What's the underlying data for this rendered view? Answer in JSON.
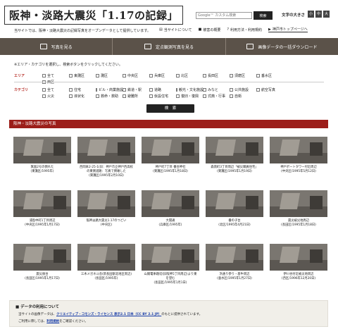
{
  "header": {
    "title": "阪神・淡路大震災「1.17の記録」",
    "search_placeholder": "Google™ カスタム検索",
    "search_button": "検索",
    "fontsize_label": "文字の大きさ",
    "fontsize_options": [
      "小",
      "中",
      "大"
    ]
  },
  "intro": "当サイトでは、阪神・淡路大震災の記録写真をオープンデータとして提供しています。",
  "toplinks": [
    {
      "label": "当サイトについて",
      "icon": "page-icon"
    },
    {
      "label": "被害の概要",
      "icon": "folder-icon"
    },
    {
      "label": "利用方法・利用規約",
      "icon": "question-icon"
    },
    {
      "label": "神戸市トップページへ",
      "icon": "arrow-icon"
    }
  ],
  "nav": [
    {
      "label": "写真を見る",
      "icon": "photo-icon"
    },
    {
      "label": "定点観測写真を見る",
      "icon": "camera-icon"
    },
    {
      "label": "画像データの一括ダウンロード",
      "icon": "download-icon"
    }
  ],
  "filter": {
    "note": "※エリア・カテゴリを選択し、検索ボタンをクリックしてください。",
    "area_label": "エリア",
    "areas": [
      "全て",
      "東灘区",
      "灘区",
      "中央区",
      "兵庫区",
      "北区",
      "長田区",
      "須磨区",
      "垂水区",
      "西区"
    ],
    "category_label": "カテゴリ",
    "categories": [
      "全て",
      "住宅",
      "ビル・商業施設",
      "鉄道・駅",
      "道路",
      "観光・文化施設",
      "みなと",
      "公共施設",
      "航空写真",
      "火災",
      "液状化",
      "救命・救助",
      "避難所",
      "仮設住宅",
      "復旧・復興",
      "式典・行事",
      "自衛"
    ],
    "search_button": "検　索"
  },
  "section_title": "阪神・淡路大震災の写真",
  "photos": [
    {
      "caption_1": "箕面2号の倒れた",
      "caption_2": "(東灘区/1995年)"
    },
    {
      "caption_1": "西岡本2-25-1(旧：神戸市立神戸西高校",
      "caption_2": "の東側道路：写真で倒壊した",
      "caption_3": "(東灘区/1995年2月10日)"
    },
    {
      "caption_1": "神戸町7丁目 番台神社",
      "caption_2": "(東灘区/1995年1月18日)"
    },
    {
      "caption_1": "森南町3丁目周辺「被災職員住宅」",
      "caption_2": "(東灘区/1995年1月19日)"
    },
    {
      "caption_1": "神戸ポートタワー付近周辺",
      "caption_2": "(中央区/1995年5月12日)"
    },
    {
      "caption_1": "浦島中町1丁目周辺",
      "caption_2": "(中央区/1995年1月17日)"
    },
    {
      "caption_1": "阪神淡路大震災1.17のつどい",
      "caption_2": "(中央区)"
    },
    {
      "caption_1": "大開通",
      "caption_2": "(兵庫区/1995年)"
    },
    {
      "caption_1": "番の子台",
      "caption_2": "(北区/1995年4月21日)"
    },
    {
      "caption_1": "震災被災地周辺",
      "caption_2": "(長田区/1995年1月18日)"
    },
    {
      "caption_1": "震災後台",
      "caption_2": "(長田区/1995年1月17日)"
    },
    {
      "caption_1": "三木メガネ斗舎(新長田駅北地区周辺)",
      "caption_2": "(長田区/1995年)"
    },
    {
      "caption_1": "山陽電車踏切(旧阪神5丁目周辺)より東",
      "caption_2": "を望む",
      "caption_3": "(長田区/1995年1月1日)"
    },
    {
      "caption_1": "浜通り参り・基牛周辺",
      "caption_2": "(垂水区/1995年1月27日)"
    },
    {
      "caption_1": "伊川谷付近被災地周辺",
      "caption_2": "(西区/1996年12月20日)"
    }
  ],
  "notice": {
    "title": "データの利用について",
    "text_1": "当サイトの画像データは、",
    "license": "クリエイティブ・コモンズ・ライセンス 表示2.1 日本（CC BY 2.1 JP）",
    "text_2": "のもとに提供されています。",
    "text_3": "ご利用に際しては、",
    "terms": "利用規約",
    "text_4": "をご確認ください。"
  },
  "colors": {
    "nav_bg": "#5b5249",
    "section_red": "#9c1e1a",
    "label_red": "#b8322b",
    "link_blue": "#1a3ea8"
  }
}
